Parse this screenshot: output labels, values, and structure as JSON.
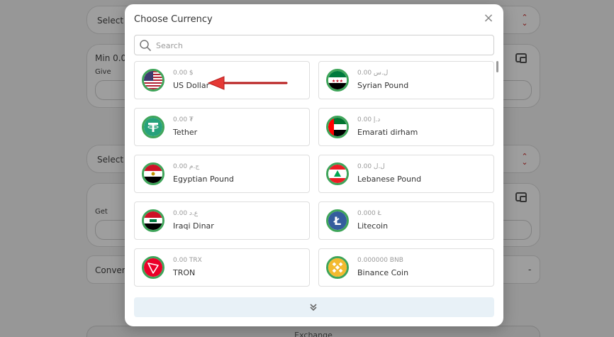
{
  "background": {
    "select_label_1": "Select C",
    "select_label_2": "Select C",
    "min_text": "Min 0.0",
    "give_label": "Give",
    "get_label": "Get",
    "conversion_label": "Convers",
    "exchange_label": "Exchange",
    "accent_color": "#c62828"
  },
  "modal": {
    "title": "Choose Currency",
    "close_symbol": "×",
    "search_placeholder": "Search",
    "search_value": ""
  },
  "currencies": [
    {
      "balance": "0.00 $",
      "name": "US Dollar",
      "icon": "us-flag-icon"
    },
    {
      "balance": "0.00 ل.س",
      "name": "Syrian Pound",
      "icon": "syria-flag-icon"
    },
    {
      "balance": "0.00 ₮",
      "name": "Tether",
      "icon": "tether-icon"
    },
    {
      "balance": "0.00 د.إ",
      "name": "Emarati dirham",
      "icon": "uae-flag-icon"
    },
    {
      "balance": "0.00 ج.م",
      "name": "Egyptian Pound",
      "icon": "egypt-flag-icon"
    },
    {
      "balance": "0.00 ل.ل",
      "name": "Lebanese Pound",
      "icon": "lebanon-flag-icon"
    },
    {
      "balance": "0.00 ع.د",
      "name": "Iraqi Dinar",
      "icon": "iraq-flag-icon"
    },
    {
      "balance": "0.000 Ł",
      "name": "Litecoin",
      "icon": "litecoin-icon"
    },
    {
      "balance": "0.00 TRX",
      "name": "TRON",
      "icon": "tron-icon"
    },
    {
      "balance": "0.000000 BNB",
      "name": "Binance Coin",
      "icon": "bnb-icon"
    }
  ]
}
